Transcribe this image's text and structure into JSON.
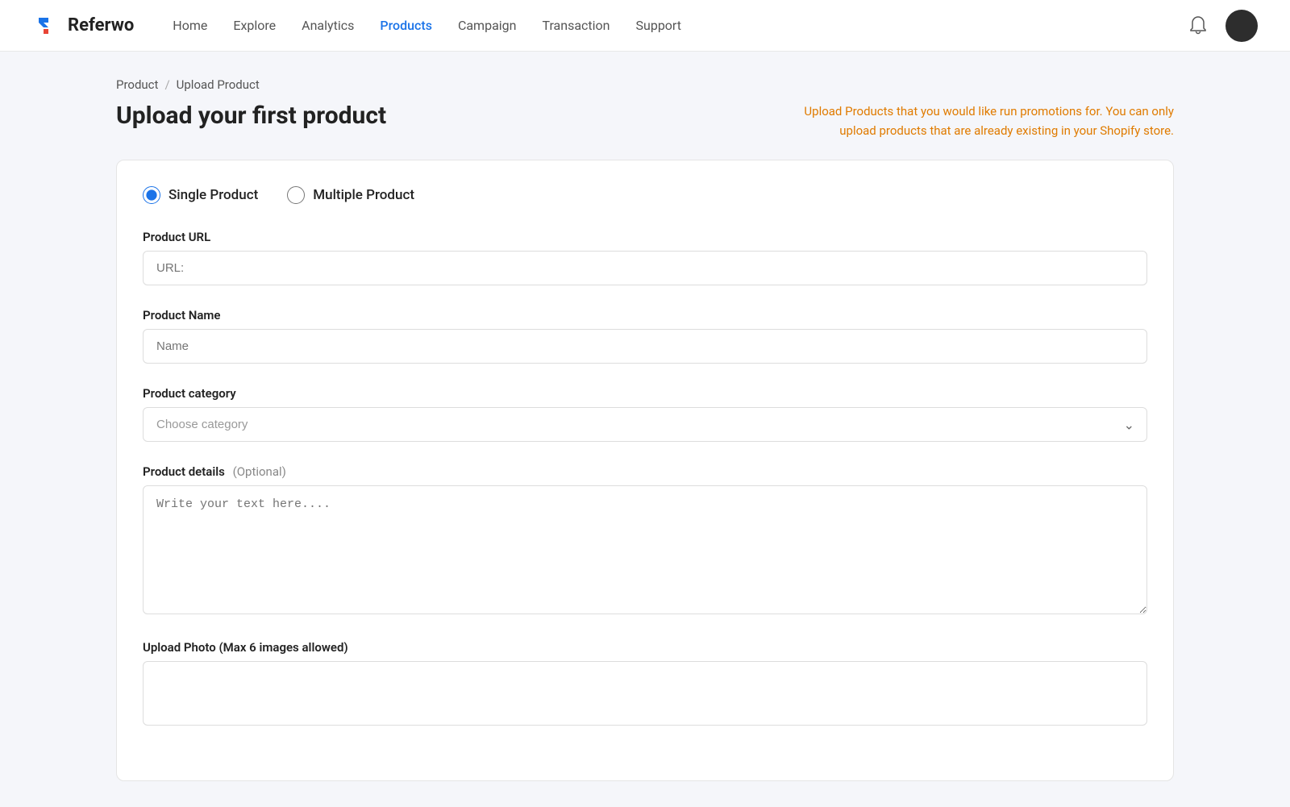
{
  "brand": {
    "name": "Referwo"
  },
  "navbar": {
    "links": [
      {
        "id": "home",
        "label": "Home",
        "active": false
      },
      {
        "id": "explore",
        "label": "Explore",
        "active": false
      },
      {
        "id": "analytics",
        "label": "Analytics",
        "active": false
      },
      {
        "id": "products",
        "label": "Products",
        "active": true
      },
      {
        "id": "campaign",
        "label": "Campaign",
        "active": false
      },
      {
        "id": "transaction",
        "label": "Transaction",
        "active": false
      },
      {
        "id": "support",
        "label": "Support",
        "active": false
      }
    ]
  },
  "breadcrumb": {
    "parent": "Product",
    "separator": "/",
    "current": "Upload Product"
  },
  "page": {
    "title": "Upload your first product",
    "hint": "Upload Products that you would like run promotions for. You can only upload products that are already existing in your Shopify store."
  },
  "form": {
    "radio_single": "Single Product",
    "radio_multiple": "Multiple Product",
    "url_label": "Product URL",
    "url_placeholder": "URL:",
    "name_label": "Product Name",
    "name_placeholder": "Name",
    "category_label": "Product category",
    "category_placeholder": "Choose category",
    "details_label": "Product details",
    "details_optional": "(Optional)",
    "details_placeholder": "Write your text here....",
    "photo_label": "Upload Photo (Max 6 images allowed)"
  }
}
